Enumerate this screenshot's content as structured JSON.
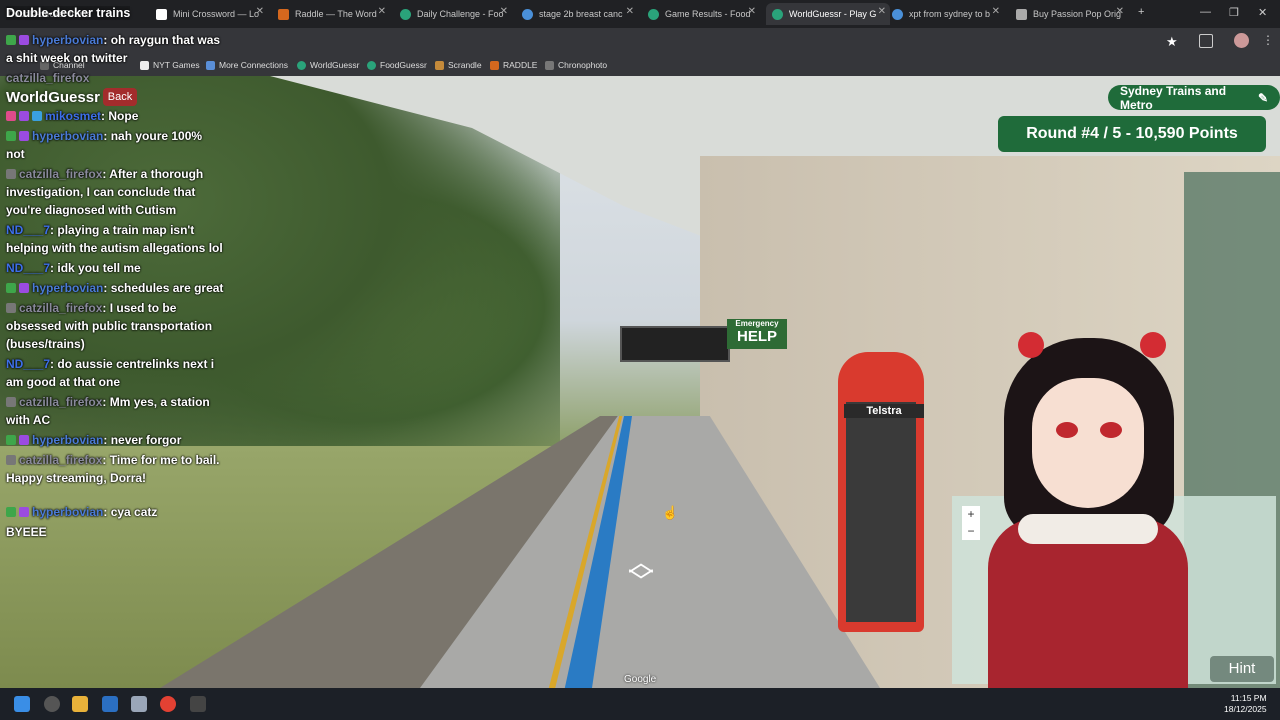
{
  "browser": {
    "tabs": [
      {
        "label": "Double-decker trains",
        "active": false
      },
      {
        "label": "Mini Crossword — Lo",
        "active": false
      },
      {
        "label": "Raddle — The Word",
        "active": false
      },
      {
        "label": "Daily Challenge - Foo",
        "active": false
      },
      {
        "label": "stage 2b breast canc",
        "active": false
      },
      {
        "label": "Game Results - Food",
        "active": false
      },
      {
        "label": "WorldGuessr - Play G",
        "active": true
      },
      {
        "label": "xpt from sydney to b",
        "active": false
      },
      {
        "label": "Buy Passion Pop Orig",
        "active": false
      }
    ],
    "bookmarks": [
      "Channel",
      "NYT Games",
      "More Connections",
      "WorldGuessr",
      "FoodGuessr",
      "Scrandle",
      "RADDLE",
      "Chronophoto"
    ]
  },
  "stream": {
    "title": "Double-decker trains"
  },
  "chat": [
    {
      "user": "hyperbovian",
      "text": "oh raygun that was a shit week on twitter",
      "user_class": "u-hyp"
    },
    {
      "user": "catzilla_firefox",
      "text": "",
      "user_class": "u-cat"
    },
    {
      "user": "mikosmet",
      "text": "Nope",
      "user_class": "u-mik"
    },
    {
      "user": "hyperbovian",
      "text": "nah youre 100% not",
      "user_class": "u-hyp"
    },
    {
      "user": "catzilla_firefox",
      "text": "After a thorough investigation, I can conclude that you're diagnosed with Cutism",
      "user_class": "u-cat"
    },
    {
      "user": "ND___7",
      "text": "playing a train map isn't helping with the autism allegations lol",
      "user_class": "u-nd"
    },
    {
      "user": "ND___7",
      "text": "idk you tell me",
      "user_class": "u-nd"
    },
    {
      "user": "hyperbovian",
      "text": "schedules are great",
      "user_class": "u-hyp"
    },
    {
      "user": "catzilla_firefox",
      "text": "I used to be obsessed with public transportation (buses/trains)",
      "user_class": "u-cat"
    },
    {
      "user": "ND___7",
      "text": "do aussie centrelinks next i am good at that one",
      "user_class": "u-nd"
    },
    {
      "user": "catzilla_firefox",
      "text": "Mm yes, a station with AC",
      "user_class": "u-cat"
    },
    {
      "user": "hyperbovian",
      "text": "never forgor",
      "user_class": "u-hyp"
    },
    {
      "user": "catzilla_firefox",
      "text": "Time for me to bail. Happy streaming, Dorra!",
      "user_class": "u-cat"
    },
    {
      "user": "hyperbovian",
      "text": "cya catz",
      "user_class": "u-cya"
    },
    {
      "user": "",
      "text": "BYEEE",
      "user_class": "u-hyp"
    }
  ],
  "game": {
    "logo": "WorldGuessr",
    "back_label": "Back",
    "map_name": "Sydney Trains and Metro",
    "round_label": "Round #4 / 5 - 10,590 Points",
    "hint_label": "Hint",
    "google_label": "Google",
    "zoom_in": "+",
    "zoom_out": "−"
  },
  "scene": {
    "help_sign_top": "Emergency",
    "help_sign": "HELP",
    "telstra": "Telstra"
  },
  "taskbar": {
    "time": "11:15 PM",
    "date": "18/12/2025"
  },
  "colors": {
    "game_green": "#1f6b3a",
    "back_red": "#a32c2c",
    "chrome_dark": "#202124"
  }
}
